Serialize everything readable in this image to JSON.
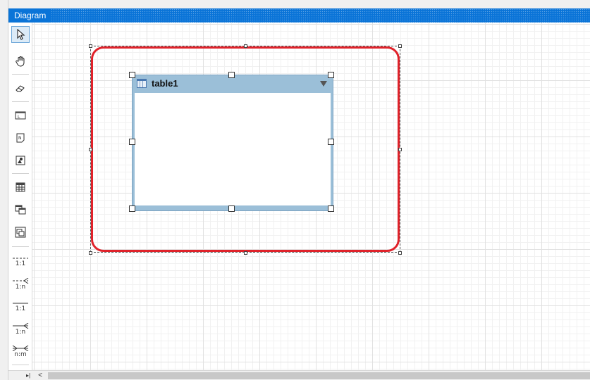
{
  "window": {
    "title": "Diagram"
  },
  "toolbox": {
    "tools": [
      {
        "name": "pointer-tool",
        "icon": "arrow-pointer-icon",
        "selected": true
      },
      {
        "name": "pan-tool",
        "icon": "hand-icon"
      },
      {
        "name": "eraser-tool",
        "icon": "eraser-icon"
      },
      {
        "name": "label-tool",
        "icon": "label-icon"
      },
      {
        "name": "note-tool",
        "icon": "note-icon"
      },
      {
        "name": "image-tool",
        "icon": "image-icon"
      },
      {
        "name": "table-tool",
        "icon": "table-icon"
      },
      {
        "name": "view-tool",
        "icon": "view-icon"
      },
      {
        "name": "group-tool",
        "icon": "group-icon"
      }
    ],
    "relations": [
      {
        "name": "relation-1-1-dashed",
        "label": "1:1"
      },
      {
        "name": "relation-1-n-dashed",
        "label": "1:n"
      },
      {
        "name": "relation-1-1",
        "label": "1:1"
      },
      {
        "name": "relation-1-n",
        "label": "1:n"
      },
      {
        "name": "relation-n-m",
        "label": "n:m"
      }
    ]
  },
  "diagram": {
    "container": {
      "border_color": "#e0222a"
    },
    "table": {
      "title": "table1",
      "header_color": "#9bbfd8"
    }
  },
  "colors": {
    "titlebar": "#0a74d8",
    "accent": "#e0222a"
  }
}
